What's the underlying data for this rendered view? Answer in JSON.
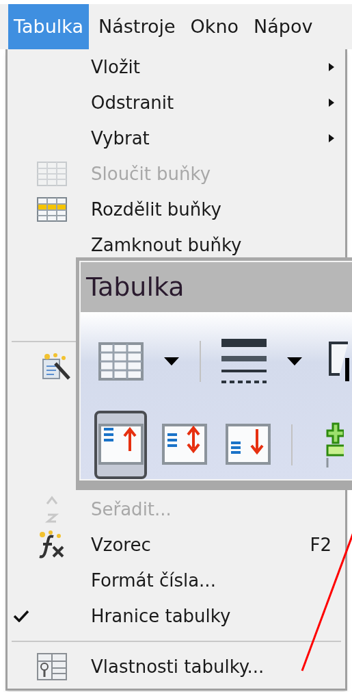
{
  "menubar": [
    {
      "label": "Tabulka",
      "selected": true
    },
    {
      "label": "Nástroje",
      "selected": false
    },
    {
      "label": "Okno",
      "selected": false
    },
    {
      "label": "Nápov",
      "selected": false
    }
  ],
  "menu": [
    {
      "kind": "item",
      "label": "Vložit",
      "disabled": false,
      "checked": false,
      "submenu": true
    },
    {
      "kind": "item",
      "label": "Odstranit",
      "disabled": false,
      "checked": false,
      "submenu": true
    },
    {
      "kind": "item",
      "label": "Vybrat",
      "disabled": false,
      "checked": false,
      "submenu": true
    },
    {
      "kind": "item",
      "label": "Sloučit buňky",
      "disabled": true,
      "checked": false,
      "submenu": false
    },
    {
      "kind": "item",
      "label": "Rozdělit buňky",
      "disabled": false,
      "checked": false,
      "submenu": false
    },
    {
      "kind": "item",
      "label": "Zamknout buňky",
      "disabled": false,
      "checked": false,
      "submenu": false
    },
    {
      "kind": "hidden"
    },
    {
      "kind": "hidden"
    },
    {
      "kind": "separator"
    },
    {
      "kind": "hidden"
    },
    {
      "kind": "hidden"
    },
    {
      "kind": "hidden"
    },
    {
      "kind": "hidden"
    },
    {
      "kind": "item",
      "label": "Seřadit...",
      "disabled": true,
      "checked": false,
      "submenu": false
    },
    {
      "kind": "item",
      "label": "Vzorec",
      "shortcut": "F2",
      "disabled": false,
      "checked": false,
      "submenu": false
    },
    {
      "kind": "item",
      "label": "Formát čísla...",
      "disabled": false,
      "checked": false,
      "submenu": false
    },
    {
      "kind": "item",
      "label": "Hranice tabulky",
      "disabled": false,
      "checked": true,
      "submenu": false
    },
    {
      "kind": "separator"
    },
    {
      "kind": "item",
      "label": "Vlastnosti tabulky...",
      "disabled": false,
      "checked": false,
      "submenu": false
    }
  ],
  "toolbar": {
    "title": "Tabulka",
    "rows": [
      [
        {
          "kind": "dropdown",
          "selected": false
        },
        {
          "kind": "separator"
        },
        {
          "kind": "dropdown",
          "selected": false
        },
        {
          "kind": "button",
          "selected": false
        }
      ],
      [
        {
          "kind": "button",
          "selected": true
        },
        {
          "kind": "button",
          "selected": false
        },
        {
          "kind": "button",
          "selected": false
        },
        {
          "kind": "separator"
        },
        {
          "kind": "button",
          "selected": false
        }
      ]
    ]
  }
}
